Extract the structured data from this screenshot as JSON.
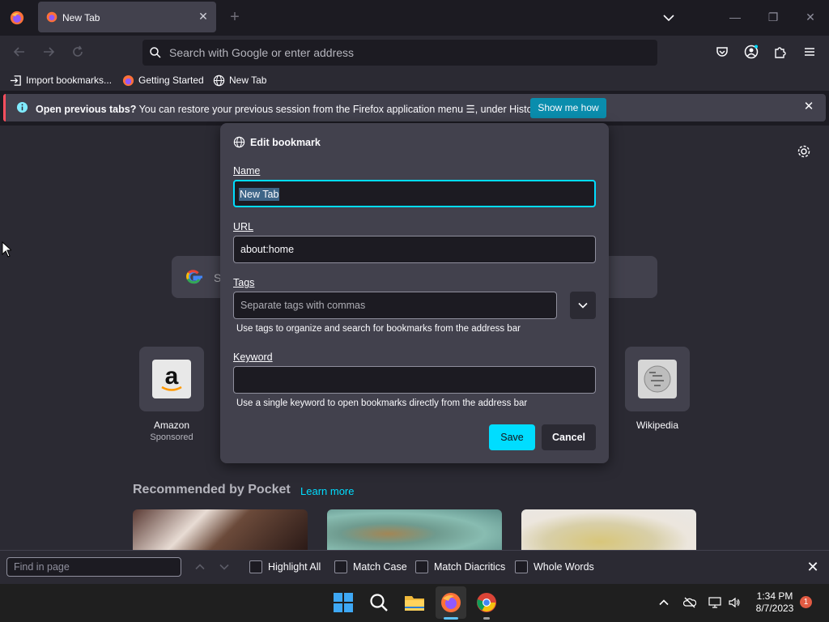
{
  "browser": {
    "tab_title": "New Tab",
    "url_placeholder": "Search with Google or enter address"
  },
  "bookmarks_bar": [
    {
      "label": "Import bookmarks..."
    },
    {
      "label": "Getting Started"
    },
    {
      "label": "New Tab"
    }
  ],
  "notification": {
    "bold_text": "Open previous tabs?",
    "text": " You can restore your previous session from the Firefox application menu ☰, under History.",
    "button": "Show me how"
  },
  "newtab": {
    "search_placeholder": "S",
    "top_sites": [
      {
        "label": "Amazon",
        "sub": "Sponsored"
      },
      {
        "label": "Wikipedia",
        "sub": ""
      }
    ],
    "pocket_title": "Recommended by Pocket",
    "pocket_learn": "Learn more"
  },
  "dialog": {
    "title": "Edit bookmark",
    "name_label": "Name",
    "name_value": "New Tab",
    "url_label": "URL",
    "url_value": "about:home",
    "tags_label": "Tags",
    "tags_placeholder": "Separate tags with commas",
    "tags_hint": "Use tags to organize and search for bookmarks from the address bar",
    "keyword_label": "Keyword",
    "keyword_value": "",
    "keyword_hint": "Use a single keyword to open bookmarks directly from the address bar",
    "save": "Save",
    "cancel": "Cancel"
  },
  "findbar": {
    "placeholder": "Find in page",
    "options": [
      "Highlight All",
      "Match Case",
      "Match Diacritics",
      "Whole Words"
    ]
  },
  "taskbar": {
    "time": "1:34 PM",
    "date": "8/7/2023",
    "badge": "1"
  },
  "colors": {
    "accent": "#00ddff",
    "info_button": "#0a8dad",
    "dialog_bg": "#42414d",
    "page_bg": "#2b2a33"
  }
}
